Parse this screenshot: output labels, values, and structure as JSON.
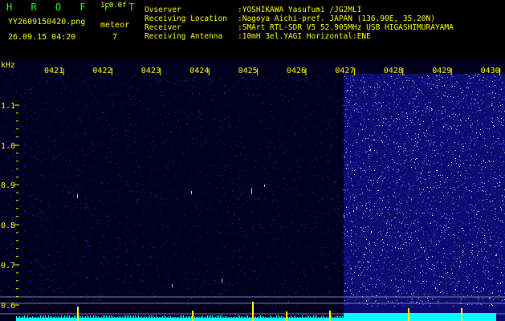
{
  "header": {
    "brand": "H R O F F T",
    "version": "1.0.0f",
    "filename": "YY2609150420.png",
    "datetime": "26.09.15 04:20",
    "event_label": "meteor",
    "event_count": "7",
    "info": [
      {
        "key": "Ovserver",
        "value": ":YOSHIKAWA Yasufumi /JG2MLI"
      },
      {
        "key": "Receiving Location",
        "value": ":Nagoya Aichi-pref. JAPAN (136.90E, 35.20N)"
      },
      {
        "key": "Receiver",
        "value": ":SMArt RTL-SDR V5 52.905MHz USB HIGASHIMURAYAMA"
      },
      {
        "key": "Receiving Antenna",
        "value": ":10mH 3el.YAGI Horizontal:ENE"
      }
    ]
  },
  "spectrogram": {
    "y_unit": "kHz",
    "y_ticks": [
      "1.1",
      "1.0",
      "0.9",
      "0.8",
      "0.7",
      "0.6"
    ],
    "x_ticks": [
      "0421",
      "0422",
      "0423",
      "0424",
      "0425",
      "0426",
      "0427",
      "0428",
      "0429",
      "0430"
    ],
    "colors": {
      "background": "#00001e",
      "noise": "#3a3aff",
      "noise_bright": "#ffffff",
      "signal": "#ffff00",
      "baseline": "#00ffff",
      "labels": "#ffff00"
    }
  }
}
